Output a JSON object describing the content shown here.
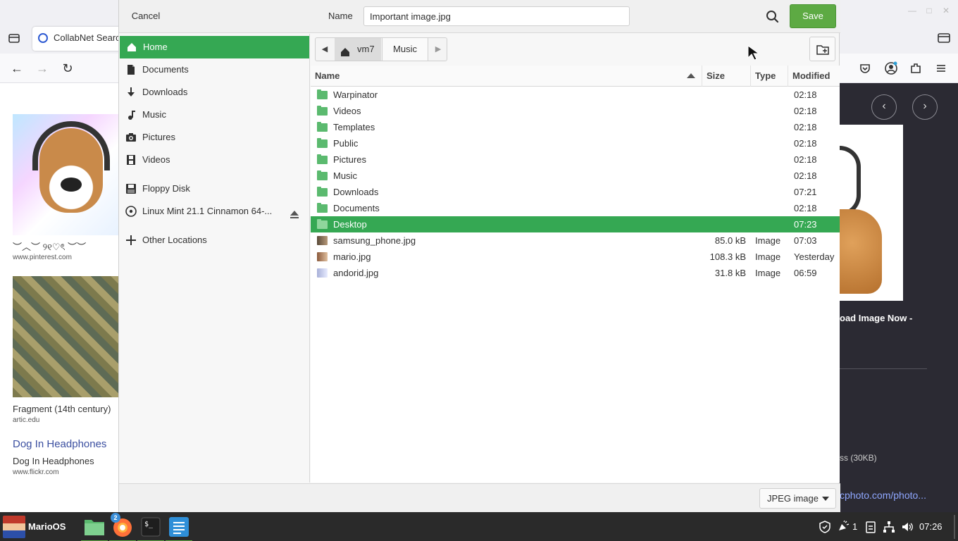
{
  "browser": {
    "tab_title": "CollabNet Searc",
    "results": [
      {
        "caption": "︶︿︶ ୨୧♡ৎ ︶︶",
        "source": "www.pinterest.com"
      },
      {
        "caption": "Fragment (14th century)",
        "source": "artic.edu"
      },
      {
        "link": "Dog In Headphones",
        "caption": "Dog In Headphones",
        "source": "www.flickr.com"
      }
    ],
    "side_panel": {
      "title_fragment": "oad Image Now -",
      "size_fragment": "ss (30KB)",
      "link_fragment": "cphoto.com/photo..."
    }
  },
  "dialog": {
    "cancel_label": "Cancel",
    "name_label": "Name",
    "name_value": "Important image.jpg",
    "save_label": "Save",
    "sidebar": [
      {
        "label": "Home",
        "icon": "home-icon",
        "active": true
      },
      {
        "label": "Documents",
        "icon": "document-icon"
      },
      {
        "label": "Downloads",
        "icon": "download-icon"
      },
      {
        "label": "Music",
        "icon": "music-icon"
      },
      {
        "label": "Pictures",
        "icon": "camera-icon"
      },
      {
        "label": "Videos",
        "icon": "film-icon"
      },
      {
        "label": "Floppy Disk",
        "icon": "floppy-icon"
      },
      {
        "label": "Linux Mint 21.1 Cinnamon 64-...",
        "icon": "optical-disc-icon"
      },
      {
        "label": "Other Locations",
        "icon": "plus-icon"
      }
    ],
    "path": [
      "vm7",
      "Music"
    ],
    "columns": {
      "name": "Name",
      "size": "Size",
      "type": "Type",
      "modified": "Modified"
    },
    "files": [
      {
        "name": "Warpinator",
        "size": "",
        "type": "",
        "modified": "02:18",
        "kind": "folder"
      },
      {
        "name": "Videos",
        "size": "",
        "type": "",
        "modified": "02:18",
        "kind": "folder"
      },
      {
        "name": "Templates",
        "size": "",
        "type": "",
        "modified": "02:18",
        "kind": "folder"
      },
      {
        "name": "Public",
        "size": "",
        "type": "",
        "modified": "02:18",
        "kind": "folder"
      },
      {
        "name": "Pictures",
        "size": "",
        "type": "",
        "modified": "02:18",
        "kind": "folder"
      },
      {
        "name": "Music",
        "size": "",
        "type": "",
        "modified": "02:18",
        "kind": "folder"
      },
      {
        "name": "Downloads",
        "size": "",
        "type": "",
        "modified": "07:21",
        "kind": "folder"
      },
      {
        "name": "Documents",
        "size": "",
        "type": "",
        "modified": "02:18",
        "kind": "folder"
      },
      {
        "name": "Desktop",
        "size": "",
        "type": "",
        "modified": "07:23",
        "kind": "folder",
        "selected": true
      },
      {
        "name": "samsung_phone.jpg",
        "size": "85.0 kB",
        "type": "Image",
        "modified": "07:03",
        "kind": "image"
      },
      {
        "name": "mario.jpg",
        "size": "108.3 kB",
        "type": "Image",
        "modified": "Yesterday",
        "kind": "image"
      },
      {
        "name": "andorid.jpg",
        "size": "31.8 kB",
        "type": "Image",
        "modified": "06:59",
        "kind": "image"
      }
    ],
    "filter": "JPEG image",
    "accent_color": "#35a853"
  },
  "taskbar": {
    "menu_label": "MarioOS",
    "apps": [
      "files-icon",
      "firefox-icon",
      "terminal-icon",
      "text-editor-icon"
    ],
    "firefox_badge": "2",
    "notifications_count": "1",
    "clock": "07:26"
  }
}
